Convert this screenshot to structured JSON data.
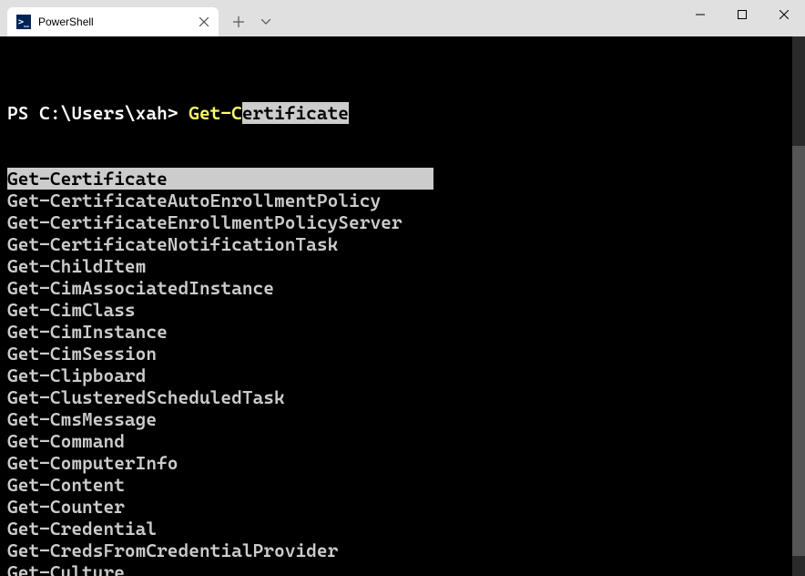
{
  "titlebar": {
    "tab_title": "PowerShell",
    "tab_icon_text": ">_"
  },
  "terminal": {
    "prompt": "PS C:\\Users\\xah> ",
    "typed": "Get-C",
    "ghost": "ertificate",
    "suggestions": [
      "Get-Certificate",
      "Get-CertificateAutoEnrollmentPolicy",
      "Get-CertificateEnrollmentPolicyServer",
      "Get-CertificateNotificationTask",
      "Get-ChildItem",
      "Get-CimAssociatedInstance",
      "Get-CimClass",
      "Get-CimInstance",
      "Get-CimSession",
      "Get-Clipboard",
      "Get-ClusteredScheduledTask",
      "Get-CmsMessage",
      "Get-Command",
      "Get-ComputerInfo",
      "Get-Content",
      "Get-Counter",
      "Get-Credential",
      "Get-CredsFromCredentialProvider",
      "Get-Culture"
    ],
    "selected_index": 0
  }
}
